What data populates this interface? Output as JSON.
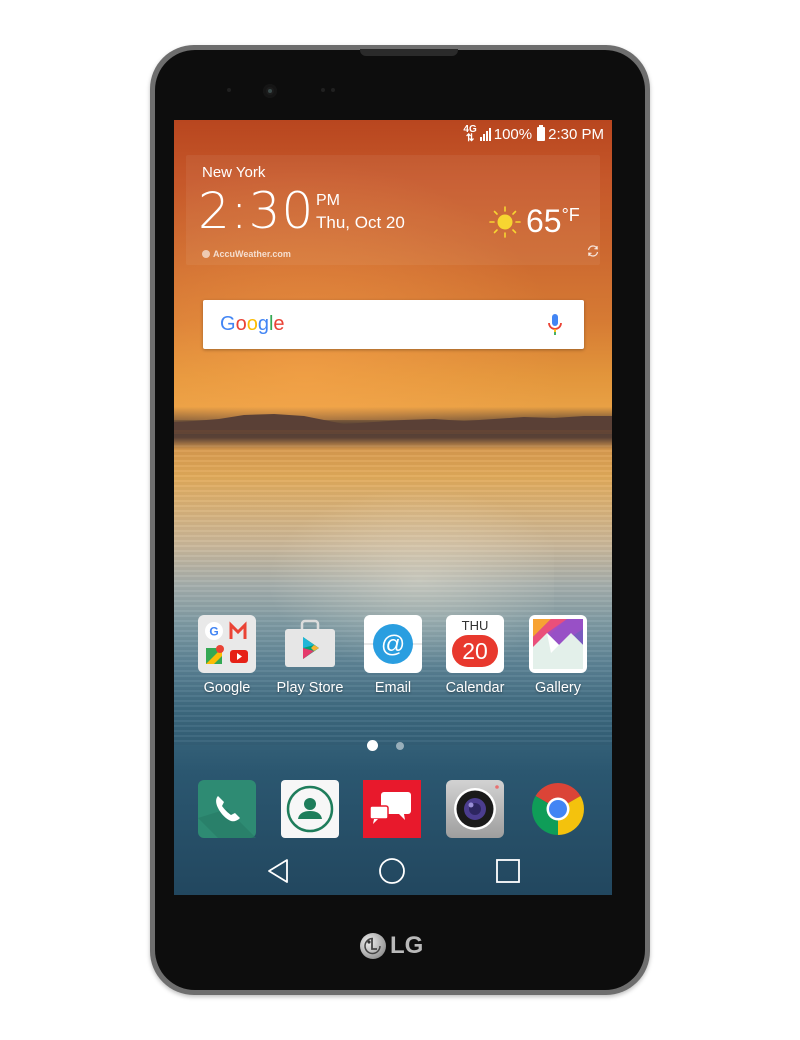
{
  "device": {
    "brand": "LG"
  },
  "status_bar": {
    "network": "4G LTE",
    "battery": "100%",
    "time": "2:30 PM",
    "icons": [
      "network-4g-icon",
      "signal-icon",
      "battery-icon"
    ]
  },
  "weather_widget": {
    "city": "New York",
    "time": "2:30",
    "ampm": "PM",
    "date": "Thu, Oct 20",
    "temperature": "65",
    "unit": "°F",
    "condition_icon": "sun-icon",
    "source": "AccuWeather.com",
    "refresh_icon": "refresh-icon"
  },
  "search_bar": {
    "logo_letters": [
      {
        "char": "G",
        "color": "#4285F4"
      },
      {
        "char": "o",
        "color": "#EA4335"
      },
      {
        "char": "o",
        "color": "#FBBC05"
      },
      {
        "char": "g",
        "color": "#4285F4"
      },
      {
        "char": "l",
        "color": "#34A853"
      },
      {
        "char": "e",
        "color": "#EA4335"
      }
    ],
    "mic_icon": "microphone-icon"
  },
  "home_apps": [
    {
      "label": "Google",
      "icon": "google-folder-icon"
    },
    {
      "label": "Play Store",
      "icon": "play-store-icon"
    },
    {
      "label": "Email",
      "icon": "email-icon"
    },
    {
      "label": "Calendar",
      "icon": "calendar-icon",
      "day": "THU",
      "date": "20"
    },
    {
      "label": "Gallery",
      "icon": "gallery-icon"
    }
  ],
  "page_indicator": {
    "pages": 2,
    "current": 1
  },
  "dock": [
    {
      "name": "Phone",
      "icon": "phone-icon",
      "color": "#2e8b73"
    },
    {
      "name": "Contacts",
      "icon": "contacts-icon",
      "color": "#1e7d5b"
    },
    {
      "name": "Messaging",
      "icon": "messaging-icon",
      "color": "#e8192c"
    },
    {
      "name": "Camera",
      "icon": "camera-icon",
      "color": "#b5b5b5"
    },
    {
      "name": "Chrome",
      "icon": "chrome-icon"
    }
  ],
  "nav_bar": {
    "back": "back-icon",
    "home": "home-icon",
    "recents": "recents-icon"
  }
}
